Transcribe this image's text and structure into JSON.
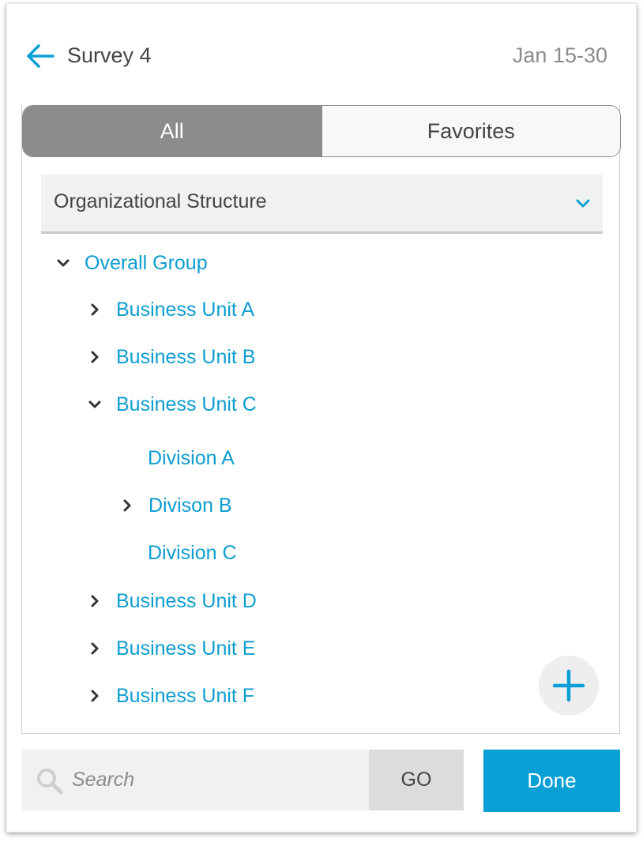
{
  "header": {
    "title": "Survey 4",
    "date_range": "Jan 15-30"
  },
  "tabs": [
    {
      "label": "All",
      "active": true
    },
    {
      "label": "Favorites",
      "active": false
    }
  ],
  "dropdown": {
    "selected": "Organizational Structure"
  },
  "tree": {
    "root": {
      "label": "Overall Group",
      "expanded": true
    },
    "units": [
      {
        "label": "Business Unit A",
        "expanded": false
      },
      {
        "label": "Business Unit B",
        "expanded": false
      },
      {
        "label": "Business Unit C",
        "expanded": true
      },
      {
        "label": "Business Unit D",
        "expanded": false
      },
      {
        "label": "Business Unit E",
        "expanded": false
      },
      {
        "label": "Business Unit F",
        "expanded": false
      }
    ],
    "divisions": [
      {
        "label": "Division A",
        "has_children": false
      },
      {
        "label": "Divison B",
        "has_children": true
      },
      {
        "label": "Division C",
        "has_children": false
      }
    ]
  },
  "search": {
    "placeholder": "Search",
    "value": "",
    "go_label": "GO"
  },
  "done_label": "Done",
  "colors": {
    "accent": "#0aa0d5",
    "link": "#0d9dd0",
    "tab_active_bg": "#8c8c8c",
    "panel_bg": "#f1f1f1"
  },
  "icons": {
    "back": "arrow-left-icon",
    "dropdown": "chevron-down-icon",
    "expanded": "chevron-down-icon",
    "collapsed": "chevron-right-icon",
    "add": "plus-icon",
    "search": "search-icon"
  }
}
